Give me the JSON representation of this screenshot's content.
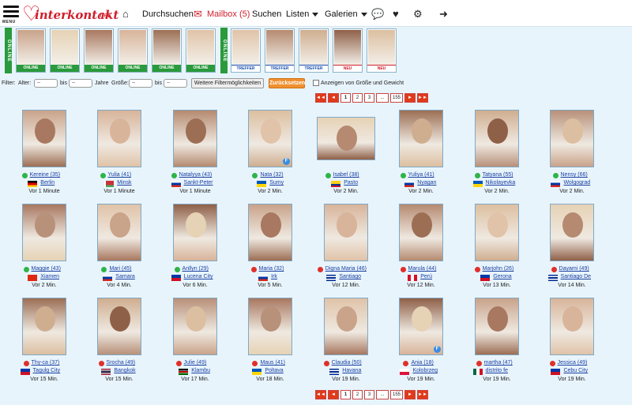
{
  "header": {
    "menu_label": "MENU",
    "logo_text": "interkontakt",
    "logo_tld": ".net",
    "nav": [
      {
        "label": "Durchsuchen"
      },
      {
        "label": "Mailbox (5)"
      },
      {
        "label": "Suchen"
      },
      {
        "label": "Listen"
      },
      {
        "label": "Galerien"
      }
    ],
    "icons": [
      "home-icon",
      "mail-icon",
      "chat-icon",
      "heart-pulse-icon",
      "gear-icon",
      "logout-icon"
    ]
  },
  "strip": {
    "online_label": "ONLINE",
    "left": [
      {
        "tag": "ONLINE"
      },
      {
        "tag": "ONLINE"
      },
      {
        "tag": "ONLINE"
      },
      {
        "tag": "ONLINE"
      },
      {
        "tag": "ONLINE"
      },
      {
        "tag": "ONLINE"
      }
    ],
    "right": [
      {
        "tag": "TREFFER"
      },
      {
        "tag": "TREFFER"
      },
      {
        "tag": "TREFFER"
      },
      {
        "tag": "NEU"
      },
      {
        "tag": "NEU"
      }
    ]
  },
  "filter": {
    "filter_label": "Filter:",
    "age_label": "Alter:",
    "age_from": "--",
    "bis1": "bis",
    "age_to": "--",
    "years": "Jahre",
    "size_label": "Größe:",
    "size_from": "--",
    "bis2": "bis",
    "size_to": "--",
    "more_button": "Weitere Filtermöglichkeiten",
    "reset_button": "Zurücksetzen",
    "show_size_weight": "Anzeigen von Größe und Gewicht"
  },
  "pager": {
    "pages": [
      "1",
      "2",
      "3",
      "...",
      "155"
    ]
  },
  "colors": {
    "accent": "#d0202c",
    "online": "#2a9a3c",
    "pager": "#e03a1a"
  },
  "profiles": [
    {
      "name": "Kereine (35)",
      "city": "Berlin",
      "time": "Vor 1 Minute",
      "status": "online",
      "flag": "de"
    },
    {
      "name": "Yulia (41)",
      "city": "Minsk",
      "time": "Vor 1 Minute",
      "status": "online",
      "flag": "by"
    },
    {
      "name": "Natalyya (43)",
      "city": "Sankt-Peter",
      "time": "Vor 1 Minute",
      "status": "online",
      "flag": "ru"
    },
    {
      "name": "Nata (32)",
      "city": "Sumy",
      "time": "Vor 2 Min.",
      "status": "online",
      "flag": "ua"
    },
    {
      "name": "Isabel (38)",
      "city": "Pasto",
      "time": "Vor 2 Min.",
      "status": "online",
      "flag": "co"
    },
    {
      "name": "Yuliya (41)",
      "city": "Nyagan",
      "time": "Vor 2 Min.",
      "status": "online",
      "flag": "ru"
    },
    {
      "name": "Tatyana (55)",
      "city": "Nikolayevka",
      "time": "Vor 2 Min.",
      "status": "online",
      "flag": "ua"
    },
    {
      "name": "Nensy (66)",
      "city": "Wolgograd",
      "time": "Vor 2 Min.",
      "status": "online",
      "flag": "ru"
    },
    {
      "name": "Maggie (43)",
      "city": "Xiamen",
      "time": "Vor 2 Min.",
      "status": "online",
      "flag": "cn"
    },
    {
      "name": "Mari (45)",
      "city": "Samara",
      "time": "Vor 4 Min.",
      "status": "online",
      "flag": "ru"
    },
    {
      "name": "Anllyn (29)",
      "city": "Lucena City",
      "time": "Vor 6 Min.",
      "status": "online",
      "flag": "ph"
    },
    {
      "name": "Maria (32)",
      "city": "Irk",
      "time": "Vor 5 Min.",
      "status": "offline",
      "flag": "ru"
    },
    {
      "name": "Digna Maria (46)",
      "city": "Santiago",
      "time": "Vor 12 Min.",
      "status": "offline",
      "flag": "cu"
    },
    {
      "name": "Marula (44)",
      "city": "Perú",
      "time": "Vor 12 Min.",
      "status": "offline",
      "flag": "pe"
    },
    {
      "name": "Marjohn (26)",
      "city": "Gerona",
      "time": "Vor 13 Min.",
      "status": "offline",
      "flag": "ph"
    },
    {
      "name": "Dayami (49)",
      "city": "Santiago De",
      "time": "Vor 14 Min.",
      "status": "offline",
      "flag": "cu"
    },
    {
      "name": "Thy-ca (37)",
      "city": "Tagulg City",
      "time": "Vor 15 Min.",
      "status": "offline",
      "flag": "ph"
    },
    {
      "name": "Srocha (49)",
      "city": "Bangkok",
      "time": "Vor 15 Min.",
      "status": "offline",
      "flag": "th"
    },
    {
      "name": "Julie (49)",
      "city": "Klambu",
      "time": "Vor 17 Min.",
      "status": "offline",
      "flag": "ke"
    },
    {
      "name": "Maus (41)",
      "city": "Poltava",
      "time": "Vor 18 Min.",
      "status": "offline",
      "flag": "ua"
    },
    {
      "name": "Claudia (50)",
      "city": "Havana",
      "time": "Vor 19 Min.",
      "status": "offline",
      "flag": "cu"
    },
    {
      "name": "Ania (18)",
      "city": "Kolobrzeg",
      "time": "Vor 19 Min.",
      "status": "offline",
      "flag": "pl"
    },
    {
      "name": "martha (47)",
      "city": "distrito fe",
      "time": "Vor 19 Min.",
      "status": "offline",
      "flag": "mx"
    },
    {
      "name": "Jessica (49)",
      "city": "Cebu City",
      "time": "Vor 19 Min.",
      "status": "offline",
      "flag": "ph"
    }
  ]
}
